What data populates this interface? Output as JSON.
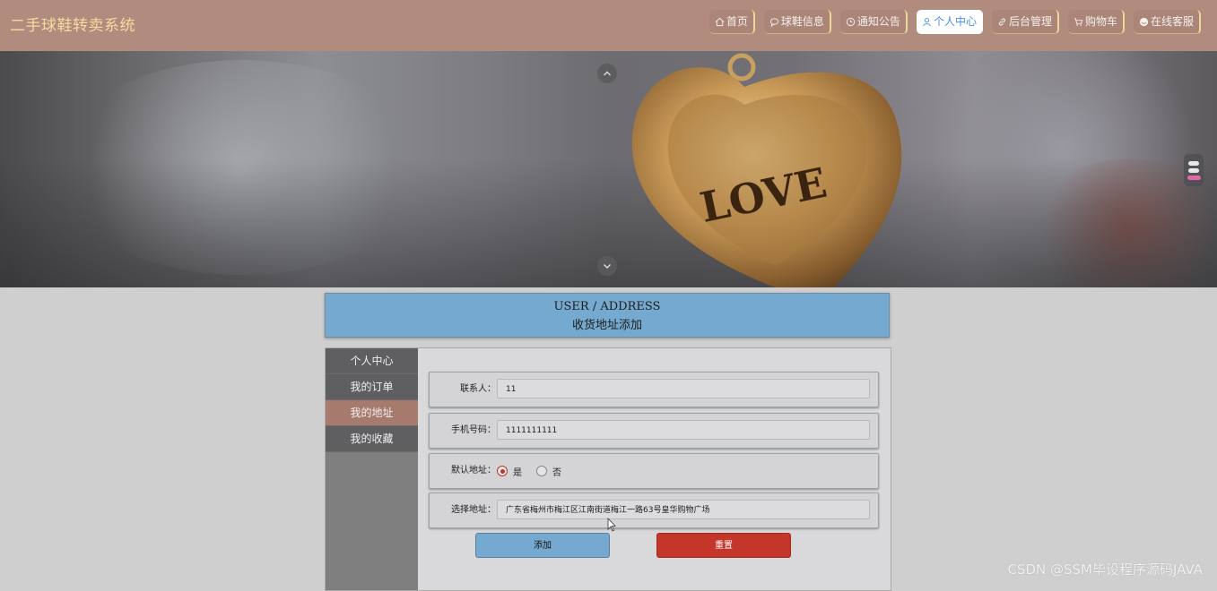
{
  "site": {
    "title": "二手球鞋转卖系统"
  },
  "nav": [
    {
      "icon": "home-icon",
      "label": "首页"
    },
    {
      "icon": "chat-icon",
      "label": "球鞋信息"
    },
    {
      "icon": "clock-icon",
      "label": "通知公告"
    },
    {
      "icon": "user-icon",
      "label": "个人中心",
      "active": true
    },
    {
      "icon": "link-icon",
      "label": "后台管理"
    },
    {
      "icon": "cart-icon",
      "label": "购物车"
    },
    {
      "icon": "support-icon",
      "label": "在线客服"
    }
  ],
  "banner": {
    "heart_text": "LOVE"
  },
  "header": {
    "title_en": "USER / ADDRESS",
    "title_cn": "收货地址添加"
  },
  "sidebar": {
    "items": [
      {
        "label": "个人中心"
      },
      {
        "label": "我的订单"
      },
      {
        "label": "我的地址",
        "active": true
      },
      {
        "label": "我的收藏"
      }
    ]
  },
  "form": {
    "contact": {
      "label": "联系人：",
      "value": "11"
    },
    "phone": {
      "label": "手机号码：",
      "value": "1111111111"
    },
    "default": {
      "label": "默认地址：",
      "yes": "是",
      "no": "否",
      "selected": "yes"
    },
    "address": {
      "label": "选择地址：",
      "value": "广东省梅州市梅江区江南街道梅江一路63号皇华购物广场"
    },
    "add_label": "添加",
    "reset_label": "重置"
  },
  "watermark": "CSDN @SSM毕设程序源码JAVA",
  "colors": {
    "topbar": "#b18b7e",
    "accent_blue": "#76a9d0",
    "reset_red": "#c4362a",
    "active_side": "#a67a6c"
  }
}
